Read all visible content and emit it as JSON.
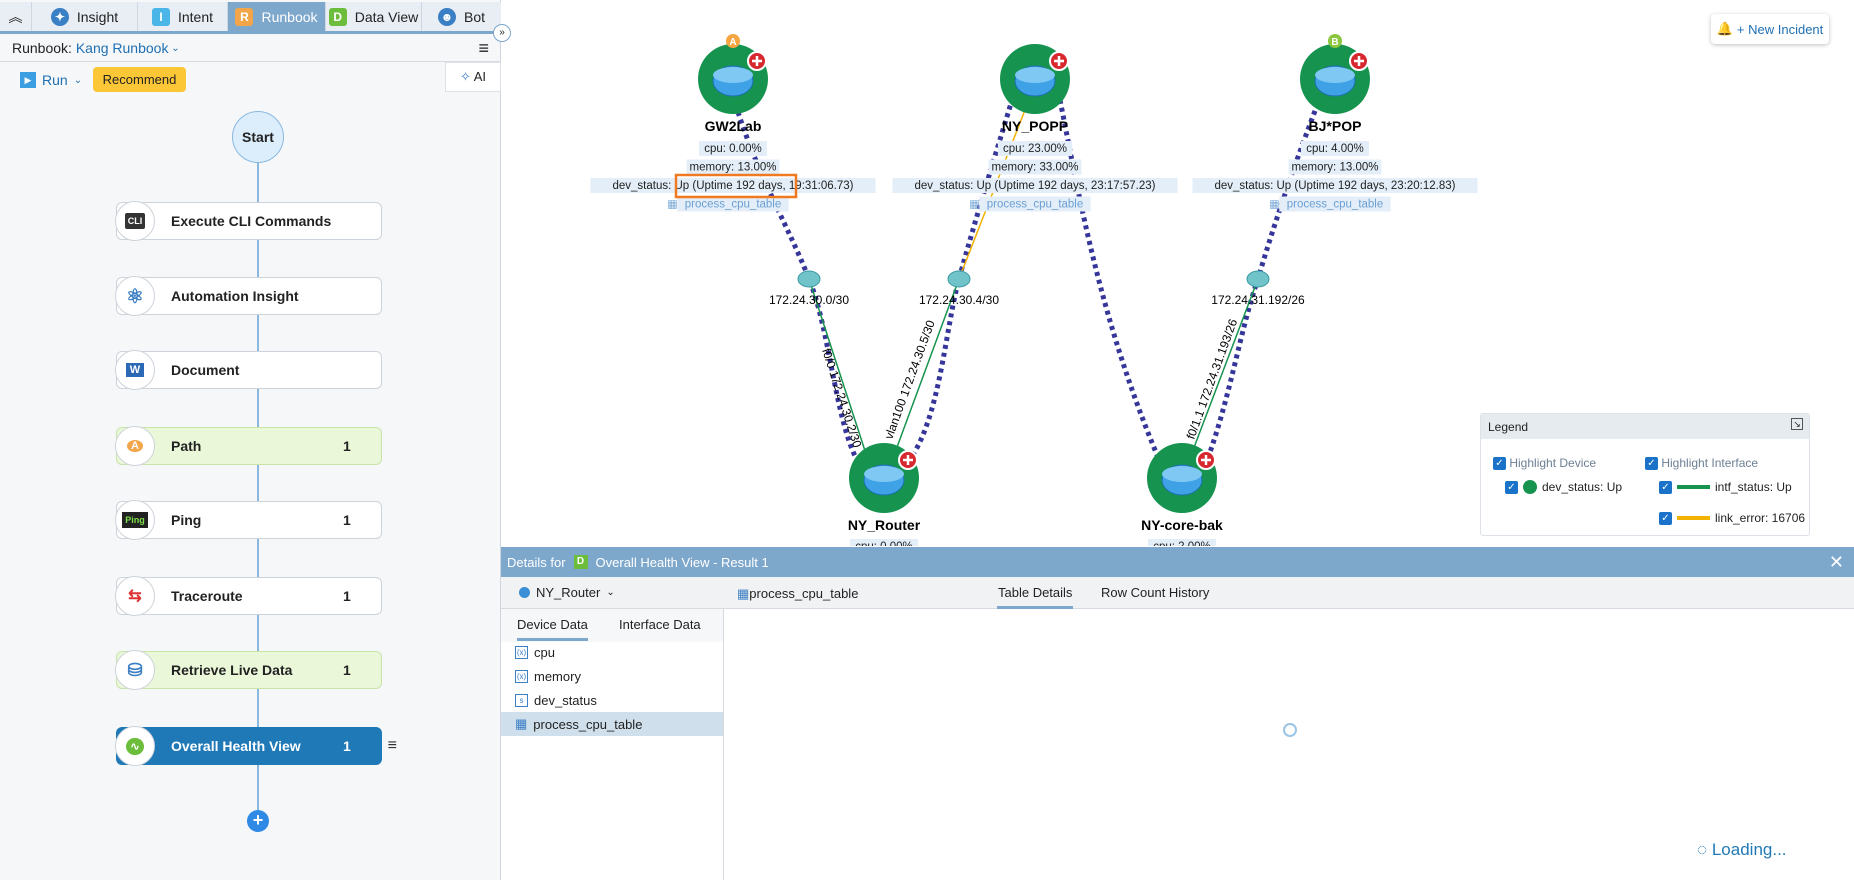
{
  "tabs": [
    {
      "label": "Insight",
      "icon": "insight-ai-icon"
    },
    {
      "label": "Intent",
      "icon": "I"
    },
    {
      "label": "Runbook",
      "icon": "R"
    },
    {
      "label": "Data View",
      "icon": "D"
    },
    {
      "label": "Bot",
      "icon": "bot-icon"
    }
  ],
  "runbook": {
    "prefix": "Runbook:",
    "name": "Kang Runbook",
    "run_label": "Run",
    "recommend_label": "Recommend",
    "ai_label": "AI"
  },
  "flow": {
    "start": "Start",
    "nodes": [
      {
        "label": "Execute CLI Commands",
        "icon": "CLI",
        "count": ""
      },
      {
        "label": "Automation Insight",
        "icon": "atom",
        "count": ""
      },
      {
        "label": "Document",
        "icon": "W",
        "count": ""
      },
      {
        "label": "Path",
        "icon": "AB",
        "count": "1"
      },
      {
        "label": "Ping",
        "icon": "Ping",
        "count": "1"
      },
      {
        "label": "Traceroute",
        "icon": "trace",
        "count": "1"
      },
      {
        "label": "Retrieve Live Data",
        "icon": "db",
        "count": "1"
      },
      {
        "label": "Overall Health View",
        "icon": "pulse",
        "count": "1"
      }
    ]
  },
  "map": {
    "new_incident": "+ New Incident",
    "devices": [
      {
        "name": "GW2Lab",
        "badge": "A",
        "cpu": "cpu: 0.00%",
        "memory": "memory: 13.00%",
        "status": "dev_status: Up (Uptime 192 days, 19:31:06.73)",
        "table": "process_cpu_table"
      },
      {
        "name": "NY_POPP",
        "badge": "",
        "cpu": "cpu: 23.00%",
        "memory": "memory: 33.00%",
        "status": "dev_status: Up (Uptime 192 days, 23:17:57.23)",
        "table": "process_cpu_table"
      },
      {
        "name": "BJ*POP",
        "badge": "B",
        "cpu": "cpu: 4.00%",
        "memory": "memory: 13.00%",
        "status": "dev_status: Up (Uptime 192 days, 23:20:12.83)",
        "table": "process_cpu_table"
      },
      {
        "name": "NY_Router",
        "cpu": "cpu: 0.00%"
      },
      {
        "name": "NY-core-bak",
        "cpu": "cpu: 2.00%"
      }
    ],
    "subnets": [
      "172.24.30.0/30",
      "172.24.30.4/30",
      "172.24.31.192/26"
    ],
    "interfaces": [
      "f0/0 172.24.30.2/30",
      "vlan100 172.24.30.5/30",
      "f0/1.1 172.24.31.193/26"
    ],
    "colors": {
      "link": "#35359a",
      "up": "#16934f",
      "error": "#f2b200",
      "device": "#16934f"
    }
  },
  "legend": {
    "title": "Legend",
    "highlight_device": "Highlight Device",
    "highlight_interface": "Highlight Interface",
    "dev_status": "dev_status: Up",
    "intf_status": "intf_status: Up",
    "link_error": "link_error: 16706"
  },
  "details": {
    "prefix": "Details for",
    "badge": "D",
    "title": "Overall Health View - Result 1",
    "device": "NY_Router",
    "table": "process_cpu_table",
    "tabs": [
      "Table Details",
      "Row Count History"
    ],
    "subtabs": [
      "Device Data",
      "Interface Data"
    ],
    "items": [
      {
        "label": "cpu",
        "type": "x"
      },
      {
        "label": "memory",
        "type": "x"
      },
      {
        "label": "dev_status",
        "type": "s"
      },
      {
        "label": "process_cpu_table",
        "type": "table"
      }
    ],
    "loading": "Loading..."
  }
}
